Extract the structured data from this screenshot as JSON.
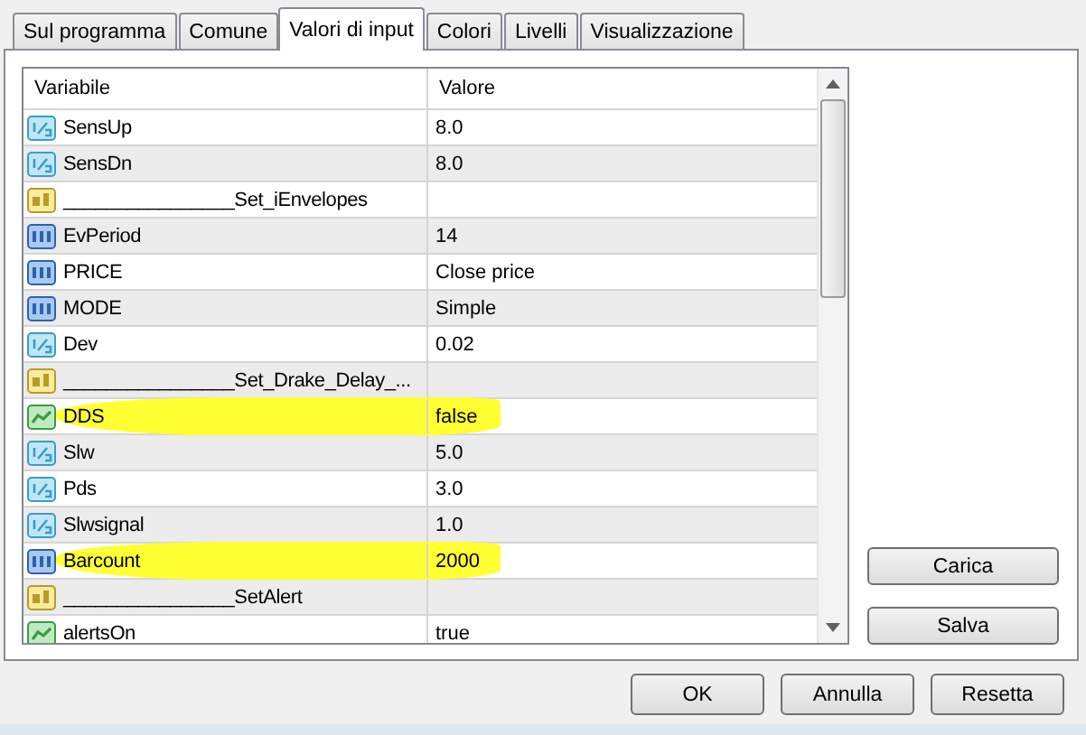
{
  "tabs": [
    {
      "label": "Sul programma",
      "selected": false
    },
    {
      "label": "Comune",
      "selected": false
    },
    {
      "label": "Valori di input",
      "selected": true
    },
    {
      "label": "Colori",
      "selected": false
    },
    {
      "label": "Livelli",
      "selected": false
    },
    {
      "label": "Visualizzazione",
      "selected": false
    }
  ],
  "table": {
    "columns": [
      "Variabile",
      "Valore"
    ],
    "rows": [
      {
        "kind": "double",
        "name": "SensUp",
        "value": "8.0",
        "highlighted": false
      },
      {
        "kind": "double",
        "name": "SensDn",
        "value": "8.0",
        "highlighted": false
      },
      {
        "kind": "string",
        "name": "________________Set_iEnvelopes",
        "value": "",
        "highlighted": false
      },
      {
        "kind": "int",
        "name": "EvPeriod",
        "value": "14",
        "highlighted": false
      },
      {
        "kind": "int",
        "name": "PRICE",
        "value": "Close price",
        "highlighted": false
      },
      {
        "kind": "int",
        "name": "MODE",
        "value": "Simple",
        "highlighted": false
      },
      {
        "kind": "double",
        "name": "Dev",
        "value": "0.02",
        "highlighted": false
      },
      {
        "kind": "string",
        "name": "________________Set_Drake_Delay_...",
        "value": "",
        "highlighted": false
      },
      {
        "kind": "bool",
        "name": "DDS",
        "value": "false",
        "highlighted": true
      },
      {
        "kind": "double",
        "name": "Slw",
        "value": "5.0",
        "highlighted": false
      },
      {
        "kind": "double",
        "name": "Pds",
        "value": "3.0",
        "highlighted": false
      },
      {
        "kind": "double",
        "name": "Slwsignal",
        "value": "1.0",
        "highlighted": false
      },
      {
        "kind": "int",
        "name": "Barcount",
        "value": "2000",
        "highlighted": true
      },
      {
        "kind": "string",
        "name": "________________SetAlert",
        "value": "",
        "highlighted": false
      },
      {
        "kind": "bool",
        "name": "alertsOn",
        "value": "true",
        "highlighted": false
      }
    ]
  },
  "side_buttons": [
    "Carica",
    "Salva"
  ],
  "buttons": [
    "OK",
    "Annulla",
    "Resetta"
  ]
}
